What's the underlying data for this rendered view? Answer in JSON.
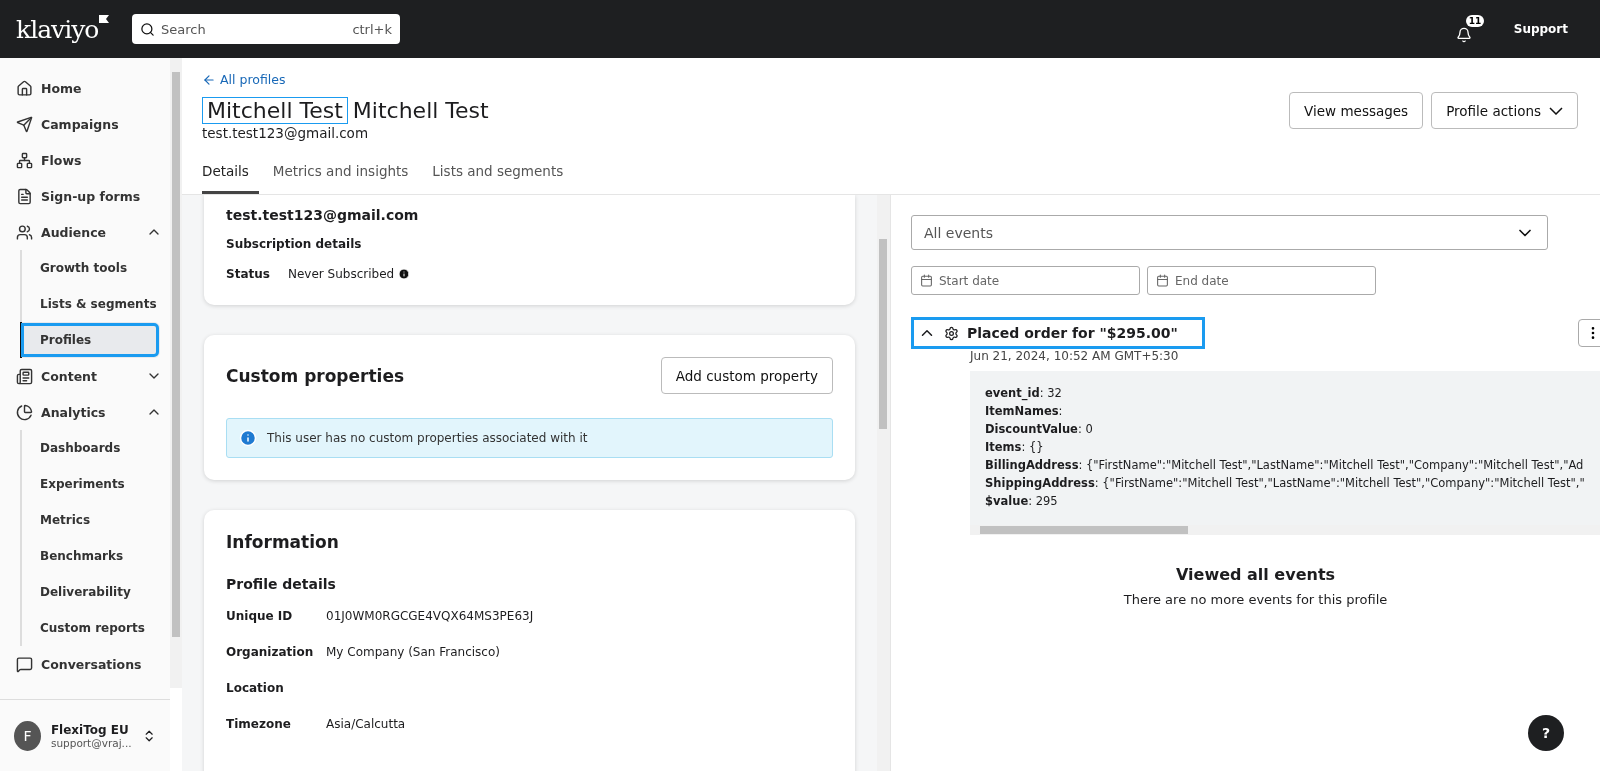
{
  "topbar": {
    "logo": "klaviyo",
    "search": {
      "placeholder": "Search",
      "shortcut": "ctrl+k"
    },
    "notifications": "11",
    "support": "Support"
  },
  "sidebar": {
    "items": [
      {
        "kind": "nav",
        "label": "Home",
        "selected": false,
        "highlighted": false
      },
      {
        "kind": "nav",
        "label": "Campaigns",
        "selected": false,
        "highlighted": false
      },
      {
        "kind": "nav",
        "label": "Flows",
        "selected": false,
        "highlighted": false
      },
      {
        "kind": "nav",
        "label": "Sign-up forms",
        "selected": false,
        "highlighted": false
      },
      {
        "kind": "group",
        "label": "Audience",
        "expanded": true,
        "children": [
          {
            "label": "Growth tools",
            "selected": false,
            "highlighted": false
          },
          {
            "label": "Lists & segments",
            "selected": false,
            "highlighted": false
          },
          {
            "label": "Profiles",
            "selected": true,
            "highlighted": true
          }
        ]
      },
      {
        "kind": "group",
        "label": "Content",
        "expanded": false
      },
      {
        "kind": "group",
        "label": "Analytics",
        "expanded": true,
        "children": [
          {
            "label": "Dashboards",
            "selected": false,
            "highlighted": false
          },
          {
            "label": "Experiments",
            "selected": false,
            "highlighted": false
          },
          {
            "label": "Metrics",
            "selected": false,
            "highlighted": false
          },
          {
            "label": "Benchmarks",
            "selected": false,
            "highlighted": false
          },
          {
            "label": "Deliverability",
            "selected": false,
            "highlighted": false
          },
          {
            "label": "Custom reports",
            "selected": false,
            "highlighted": false
          }
        ]
      },
      {
        "kind": "nav",
        "label": "Conversations",
        "selected": false,
        "highlighted": false
      }
    ],
    "account": {
      "initial": "F",
      "name": "FlexiTog EU",
      "email": "support@vraj..."
    }
  },
  "header": {
    "back_link": "All profiles",
    "name_parts": [
      {
        "text": "Mitchell Test",
        "highlighted": true
      },
      {
        "text": "Mitchell Test",
        "highlighted": false
      }
    ],
    "email": "test.test123@gmail.com",
    "buttons": [
      "View messages",
      "Profile actions"
    ],
    "tabs": [
      {
        "label": "Details",
        "selected": true
      },
      {
        "label": "Metrics and insights",
        "selected": false
      },
      {
        "label": "Lists and segments",
        "selected": false
      }
    ]
  },
  "subscription_card": {
    "email": "test.test123@gmail.com",
    "heading": "Subscription details",
    "status_label": "Status",
    "status_value": "Never Subscribed"
  },
  "custom_properties": {
    "title": "Custom properties",
    "button": "Add custom property",
    "notice": "This user has no custom properties associated with it"
  },
  "information": {
    "title": "Information",
    "section": "Profile details",
    "rows": [
      {
        "label": "Unique ID",
        "value": "01J0WM0RGCGE4VQX64MS3PE63J"
      },
      {
        "label": "Organization",
        "value": "My Company (San Francisco)"
      },
      {
        "label": "Location"
      },
      {
        "label": "Timezone",
        "value": "Asia/Calcutta"
      }
    ]
  },
  "events": {
    "filter": "All events",
    "start_placeholder": "Start date",
    "end_placeholder": "End date",
    "items": [
      {
        "title": "Placed order for \"$295.00\"",
        "expanded": true,
        "highlighted": true,
        "time": "Jun 21, 2024, 10:52 AM GMT+5:30",
        "properties": [
          {
            "key": "event_id",
            "value": ": 32"
          },
          {
            "key": "ItemNames",
            "value": ":"
          },
          {
            "key": "DiscountValue",
            "value": ": 0"
          },
          {
            "key": "Items",
            "value": ": {}"
          },
          {
            "key": "BillingAddress",
            "value": ": {\"FirstName\":\"Mitchell Test\",\"LastName\":\"Mitchell Test\",\"Company\":\"Mitchell Test\",\"Ad"
          },
          {
            "key": "ShippingAddress",
            "value": ": {\"FirstName\":\"Mitchell Test\",\"LastName\":\"Mitchell Test\",\"Company\":\"Mitchell Test\",\""
          },
          {
            "key": "$value",
            "value": ": 295"
          }
        ]
      }
    ],
    "end_title": "Viewed all events",
    "end_text": "There are no more events for this profile"
  },
  "help": "?"
}
